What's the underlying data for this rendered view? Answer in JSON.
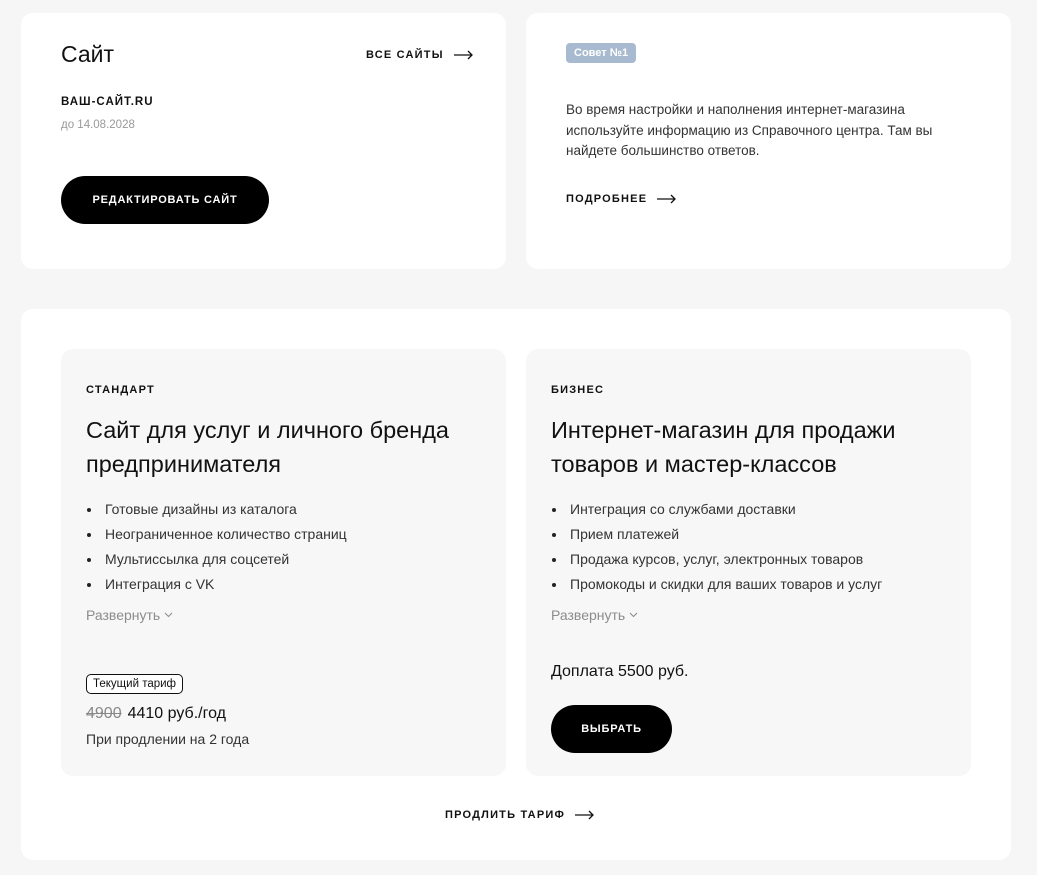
{
  "site_card": {
    "title": "Сайт",
    "all_sites_label": "ВСЕ САЙТЫ",
    "domain": "ВАШ-САЙТ.RU",
    "valid_until": "до 14.08.2028",
    "edit_button_label": "РЕДАКТИРОВАТЬ САЙТ"
  },
  "tip_card": {
    "badge": "Совет №1",
    "text": "Во время настройки и наполнения интернет-магазина используйте информацию из Справочного центра. Там вы найдете большинство ответов.",
    "more_label": "ПОДРОБНЕЕ"
  },
  "plans": {
    "standard": {
      "tag": "СТАНДАРТ",
      "title": "Сайт для услуг и личного бренда предпринимателя",
      "features": [
        "Готовые дизайны из каталога",
        "Неограниченное количество страниц",
        "Мультиссылка для соцсетей",
        "Интеграция с VK"
      ],
      "expand_label": "Развернуть",
      "current_badge": "Текущий тариф",
      "old_price": "4900",
      "price": "4410 руб./год",
      "price_note": "При продлении на 2 года"
    },
    "business": {
      "tag": "БИЗНЕС",
      "title": "Интернет-магазин для продажи товаров и мастер-классов",
      "features": [
        "Интеграция со службами доставки",
        "Прием платежей",
        "Продажа курсов, услуг, электронных товаров",
        "Промокоды и скидки для ваших товаров и услуг"
      ],
      "expand_label": "Развернуть",
      "surcharge": "Доплата 5500 руб.",
      "select_button_label": "ВЫБРАТЬ"
    },
    "extend_label": "ПРОДЛИТЬ ТАРИФ"
  },
  "colors": {
    "page_bg": "#f6f6f6",
    "badge_bg": "#a8bad0",
    "button_bg": "#000000"
  },
  "icons": [
    "arrow-right-icon",
    "chevron-down-icon"
  ]
}
